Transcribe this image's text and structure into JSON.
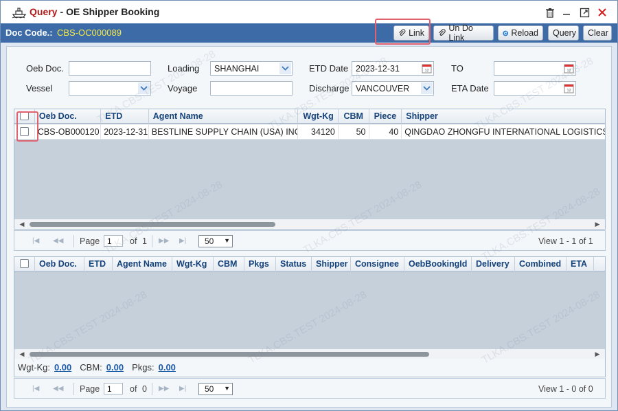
{
  "window": {
    "title_query": "Query",
    "title_separator": "-",
    "title_name": "OE Shipper Booking"
  },
  "header": {
    "doc_code_label": "Doc Code.:",
    "doc_code_value": "CBS-OC000089",
    "buttons": {
      "link": "Link",
      "undo_link": "Un Do Link",
      "reload": "Reload",
      "query": "Query",
      "clear": "Clear"
    }
  },
  "form": {
    "oeb_doc_label": "Oeb Doc.",
    "oeb_doc_value": "",
    "loading_label": "Loading",
    "loading_value": "SHANGHAI",
    "etd_date_label": "ETD Date",
    "etd_date_value": "2023-12-31",
    "to_label": "TO",
    "to_value": "",
    "vessel_label": "Vessel",
    "vessel_value": "",
    "voyage_label": "Voyage",
    "voyage_value": "",
    "discharge_label": "Discharge",
    "discharge_value": "VANCOUVER",
    "eta_date_label": "ETA Date",
    "eta_date_value": ""
  },
  "top_grid": {
    "columns": [
      "Oeb Doc.",
      "ETD",
      "Agent Name",
      "Wgt-Kg",
      "CBM",
      "Piece",
      "Shipper"
    ],
    "rows": [
      [
        "CBS-OB000120",
        "2023-12-31",
        "BESTLINE SUPPLY CHAIN (USA) INC",
        "34120",
        "50",
        "40",
        "QINGDAO ZHONGFU INTERNATIONAL LOGISTICS"
      ]
    ],
    "pager": {
      "page_label": "Page",
      "page_value": "1",
      "of_label": "of",
      "total_pages": "1",
      "page_size": "50",
      "view_text": "View 1 - 1 of 1"
    }
  },
  "bottom_grid": {
    "columns": [
      "Oeb Doc.",
      "ETD",
      "Agent Name",
      "Wgt-Kg",
      "CBM",
      "Pkgs",
      "Status",
      "Shipper",
      "Consignee",
      "OebBookingId",
      "Delivery",
      "Combined",
      "ETA"
    ],
    "totals": {
      "wgt_label": "Wgt-Kg:",
      "wgt_value": "0.00",
      "cbm_label": "CBM:",
      "cbm_value": "0.00",
      "pkgs_label": "Pkgs:",
      "pkgs_value": "0.00"
    },
    "pager": {
      "page_label": "Page",
      "page_value": "1",
      "of_label": "of",
      "total_pages": "0",
      "page_size": "50",
      "view_text": "View 1 - 0 of 0"
    }
  },
  "watermark_text": "TLKA.CBS.TEST 2024-08-28",
  "colors": {
    "title_query": "#b01818",
    "header_bar": "#3c6ba8",
    "doc_code": "#f4e94a",
    "grid_header_text": "#15427a",
    "highlight": "#e0626f"
  }
}
